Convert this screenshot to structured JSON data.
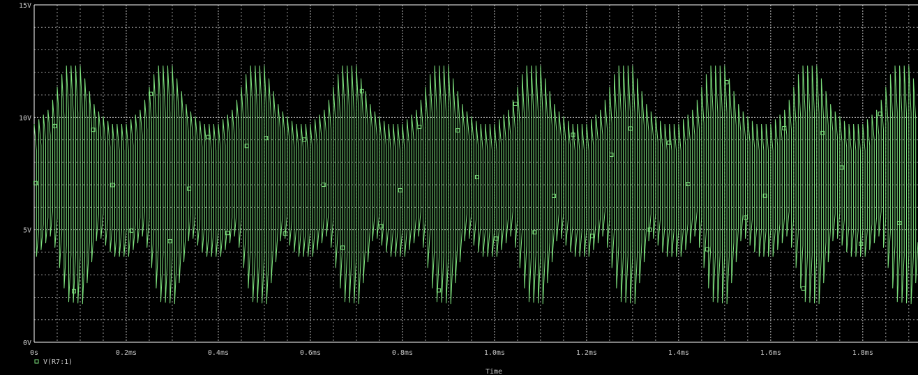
{
  "chart_data": {
    "type": "line",
    "title": "",
    "xlabel": "Time",
    "ylabel": "",
    "x_unit": "ms",
    "xlim": [
      0,
      1.92
    ],
    "ylim": [
      0,
      15
    ],
    "x_tick_values": [
      0,
      0.2,
      0.4,
      0.6,
      0.8,
      1.0,
      1.2,
      1.4,
      1.6,
      1.8
    ],
    "x_tick_labels": [
      "0s",
      "0.2ms",
      "0.4ms",
      "0.6ms",
      "0.8ms",
      "1.0ms",
      "1.2ms",
      "1.4ms",
      "1.6ms",
      "1.8ms"
    ],
    "y_tick_values": [
      0,
      5,
      10,
      15
    ],
    "y_tick_labels": [
      "0V",
      "5V",
      "10V",
      "15V"
    ],
    "grid": true,
    "grid_style": "dotted",
    "background_color": "#000000",
    "axis_color": "#ffffff",
    "text_color": "#c8c8c8",
    "legend_placement": "bottom-left",
    "series": [
      {
        "name": "V(R7:1)",
        "color": "#7ee27e",
        "marker": "square",
        "description_of_waveform": "",
        "envelope": {
          "period_ms": 0.2,
          "max_level_v": [
            9.7,
            10.4,
            12.3,
            12.3,
            10.4,
            9.7
          ],
          "min_level_v": [
            3.8,
            4.8,
            1.8,
            1.7,
            4.8,
            3.8
          ]
        },
        "pulse_rate_per_ms": 100,
        "notes": ""
      }
    ]
  }
}
